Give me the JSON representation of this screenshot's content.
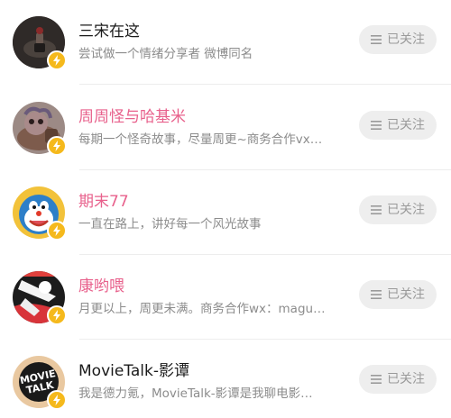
{
  "follow_list": {
    "users": [
      {
        "name": "三宋在这",
        "name_color": "#1a1a1a",
        "description": "尝试做一个情绪分享者 微博同名",
        "verified_icon": "lightning-icon",
        "follow_label": "已关注"
      },
      {
        "name": "周周怪与哈基米",
        "name_color": "#e8618c",
        "description": "每期一个怪奇故事，尽量周更~商务合作vx…",
        "verified_icon": "lightning-icon",
        "follow_label": "已关注"
      },
      {
        "name": "期末77",
        "name_color": "#e8618c",
        "description": "一直在路上，讲好每一个风光故事",
        "verified_icon": "lightning-icon",
        "follow_label": "已关注"
      },
      {
        "name": "康哟喂",
        "name_color": "#e8618c",
        "description": "月更以上，周更未满。商务合作wx：magu…",
        "verified_icon": "lightning-icon",
        "follow_label": "已关注"
      },
      {
        "name": "MovieTalk-影谭",
        "name_color": "#1a1a1a",
        "description": "我是德力氪，MovieTalk-影谭是我聊电影…",
        "verified_icon": "lightning-icon",
        "follow_label": "已关注"
      }
    ],
    "colors": {
      "vip_name": "#e8618c",
      "normal_name": "#1a1a1a",
      "badge": "#f5b91c",
      "button_bg": "#eeeeee"
    }
  }
}
